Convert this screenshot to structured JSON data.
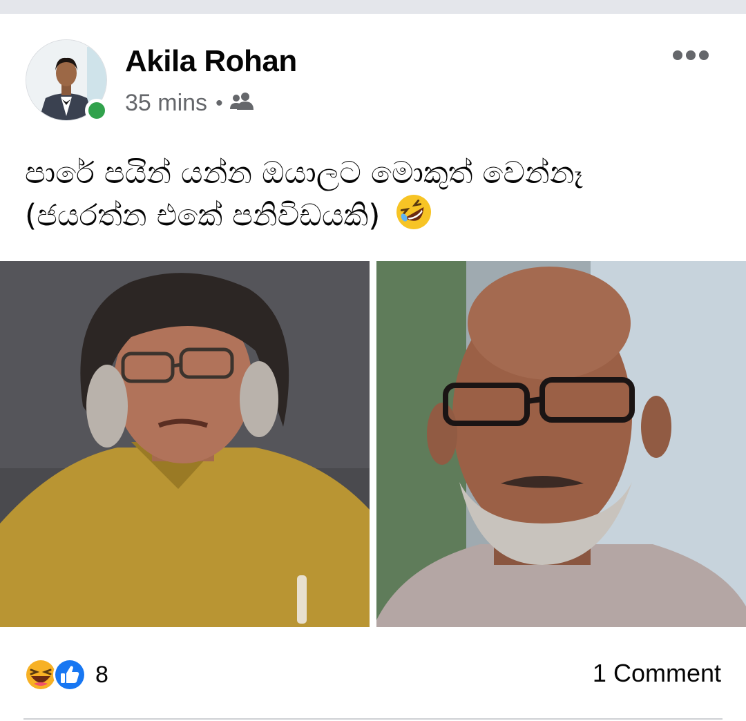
{
  "post": {
    "author": "Akila Rohan",
    "time": "35 mins",
    "separator": "•",
    "audience_icon": "friends-icon",
    "text_line1": "පාරේ පයින් යන්න ඔයාලට මොකුත් වෙන්නෑ",
    "text_line2": "(ජයරත්න එකේ පනිවිඩයකි)",
    "text_emoji": "rolling-on-floor-laughing-icon"
  },
  "reactions": {
    "icons": [
      "haha-icon",
      "like-icon"
    ],
    "count": "8"
  },
  "comments": {
    "label": "1 Comment"
  },
  "colors": {
    "online": "#31a24c",
    "like_blue": "#1877f2",
    "haha_yellow": "#f7b125",
    "meta_gray": "#65676b"
  }
}
